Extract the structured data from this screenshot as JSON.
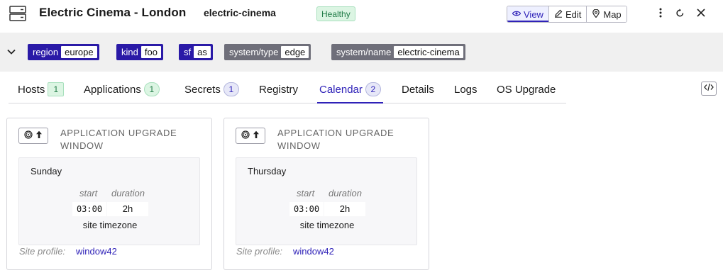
{
  "header": {
    "title": "Electric Cinema - London",
    "slug": "electric-cinema",
    "health": "Healthy",
    "view_buttons": [
      {
        "label": "View",
        "icon": "eye-icon",
        "active": true
      },
      {
        "label": "Edit",
        "icon": "pencil-icon",
        "active": false
      },
      {
        "label": "Map",
        "icon": "map-pin-icon",
        "active": false
      }
    ],
    "actions": [
      "kebab-menu-icon",
      "refresh-icon",
      "close-icon"
    ]
  },
  "labels": [
    {
      "key": "region",
      "value": "europe",
      "style": "blue"
    },
    {
      "key": "kind",
      "value": "foo",
      "style": "blue"
    },
    {
      "key": "sf",
      "value": "as",
      "style": "blue"
    },
    {
      "key": "system/type",
      "value": "edge",
      "style": "gray"
    },
    {
      "key": "system/name",
      "value": "electric-cinema",
      "style": "gray"
    }
  ],
  "tabs": [
    {
      "label": "Hosts",
      "count": "1"
    },
    {
      "label": "Applications",
      "count": "1"
    },
    {
      "label": "Secrets",
      "count": "1"
    },
    {
      "label": "Registry",
      "count": null
    },
    {
      "label": "Calendar",
      "count": "2",
      "active": true
    },
    {
      "label": "Details",
      "count": null
    },
    {
      "label": "Logs",
      "count": null
    },
    {
      "label": "OS Upgrade",
      "count": null
    }
  ],
  "cards": [
    {
      "title": "APPLICATION UPGRADE WINDOW",
      "day": "Sunday",
      "start_label": "start",
      "duration_label": "duration",
      "start": "03:00",
      "duration": "2h",
      "timezone": "site timezone",
      "profile_label": "Site profile:",
      "profile": "window42"
    },
    {
      "title": "APPLICATION UPGRADE WINDOW",
      "day": "Thursday",
      "start_label": "start",
      "duration_label": "duration",
      "start": "03:00",
      "duration": "2h",
      "timezone": "site timezone",
      "profile_label": "Site profile:",
      "profile": "window42"
    }
  ],
  "colors": {
    "accent": "#2f22b8",
    "tag_blue": "#2a1aa7",
    "tag_gray": "#6f6f7a",
    "healthy_bg": "#dcf5e3",
    "healthy_text": "#1e7a45"
  }
}
